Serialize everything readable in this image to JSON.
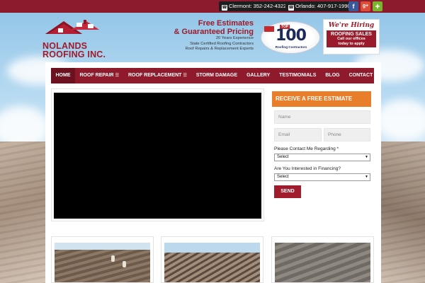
{
  "topbar": {
    "phones": [
      {
        "label": "Clermont: 352-242-4322"
      },
      {
        "label": "Orlando: 407-917-1990"
      }
    ],
    "social": [
      {
        "icon": "facebook-icon",
        "glyph": "f",
        "color": "#3b5998"
      },
      {
        "icon": "google-plus-icon",
        "glyph": "g+",
        "color": "#dd4b39"
      },
      {
        "icon": "plus-icon",
        "glyph": "+",
        "color": "#7bb32e"
      }
    ]
  },
  "logo": {
    "line1": "NOLANDS",
    "line2": "ROOFING INC."
  },
  "promo": {
    "headline1": "Free Estimates",
    "headline2": "& Guaranteed Pricing",
    "lines": [
      "20 Years Experience",
      "State Certified Roofing Contractors",
      "Roof Repairs & Replacement Experts"
    ]
  },
  "badge": {
    "top": "TOP",
    "number": "100",
    "caption": "Roofing Contractors"
  },
  "hiring": {
    "title": "We're Hiring",
    "role": "ROOFING SALES",
    "sub1": "Call our offices",
    "sub2": "today to apply"
  },
  "nav": {
    "items": [
      {
        "label": "HOME",
        "active": true,
        "dropdown": false
      },
      {
        "label": "ROOF REPAIR",
        "active": false,
        "dropdown": true
      },
      {
        "label": "ROOF REPLACEMENT",
        "active": false,
        "dropdown": true
      },
      {
        "label": "STORM DAMAGE",
        "active": false,
        "dropdown": false
      },
      {
        "label": "GALLERY",
        "active": false,
        "dropdown": false
      },
      {
        "label": "TESTIMONIALS",
        "active": false,
        "dropdown": false
      },
      {
        "label": "BLOG",
        "active": false,
        "dropdown": false
      },
      {
        "label": "CONTACT",
        "active": false,
        "dropdown": false
      }
    ]
  },
  "form": {
    "heading": "RECEIVE A FREE ESTIMATE",
    "name_placeholder": "Name",
    "email_placeholder": "Email",
    "phone_placeholder": "Phone",
    "contact_label": "Please Contact Me Regarding *",
    "contact_value": "Select",
    "financing_label": "Are You Interested in Financing?",
    "financing_value": "Select",
    "submit_label": "SEND"
  },
  "colors": {
    "brand": "#8f1a2c",
    "accent": "#e87e2a"
  }
}
